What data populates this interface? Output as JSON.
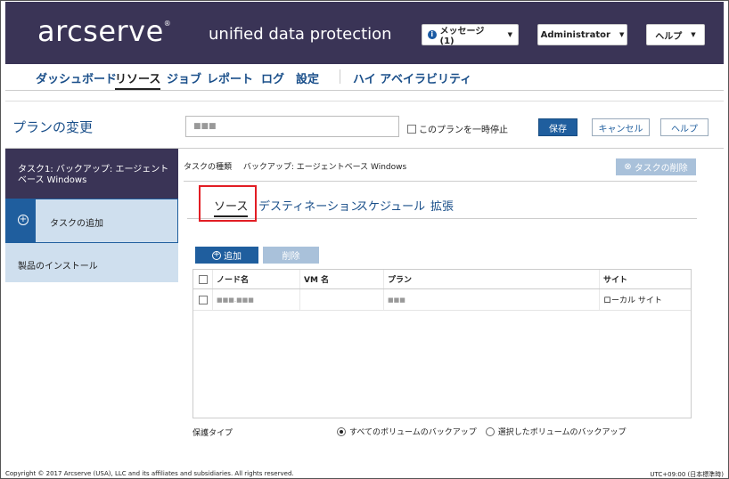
{
  "header": {
    "logo": "arcserve",
    "logo_mark": "®",
    "product": "unified data protection",
    "messages_label": "メッセージ (1)",
    "admin_label": "Administrator",
    "help_label": "ヘルプ"
  },
  "nav": {
    "items": [
      "ダッシュボード",
      "リソース",
      "ジョブ",
      "レポート",
      "ログ",
      "設定",
      "ハイ アベイラビリティ"
    ]
  },
  "toolbar": {
    "title": "プランの変更",
    "plan_name_value": "■■■",
    "pause_label": "このプランを一時停止",
    "save_label": "保存",
    "cancel_label": "キャンセル",
    "help_label": "ヘルプ"
  },
  "sidebar": {
    "task1_label": "タスク1: バックアップ: エージェント ベース Windows",
    "add_task_label": "タスクの追加",
    "install_label": "製品のインストール"
  },
  "task": {
    "type_label": "タスクの種類",
    "type_value": "バックアップ: エージェントベース Windows",
    "delete_label": "タスクの削除"
  },
  "tabs": [
    "ソース",
    "デスティネーション",
    "スケジュール",
    "拡張"
  ],
  "source": {
    "add_label": "追加",
    "remove_label": "削除",
    "columns": [
      "ノード名",
      "VM 名",
      "プラン",
      "サイト"
    ],
    "rows": [
      {
        "node": "■■■.■■■",
        "vm": "",
        "plan": "■■■",
        "site": "ローカル サイト"
      }
    ]
  },
  "protection": {
    "label": "保護タイプ",
    "option_all": "すべてのボリュームのバックアップ",
    "option_selected": "選択したボリュームのバックアップ"
  },
  "footer": {
    "copyright": "Copyright © 2017 Arcserve (USA), LLC and its affiliates and subsidiaries. All rights reserved.",
    "timezone": "UTC+09:00 (日本標準時)"
  },
  "colors": {
    "header_bg": "#3a3456",
    "primary": "#1f5e9e",
    "highlight": "#e21d24"
  }
}
